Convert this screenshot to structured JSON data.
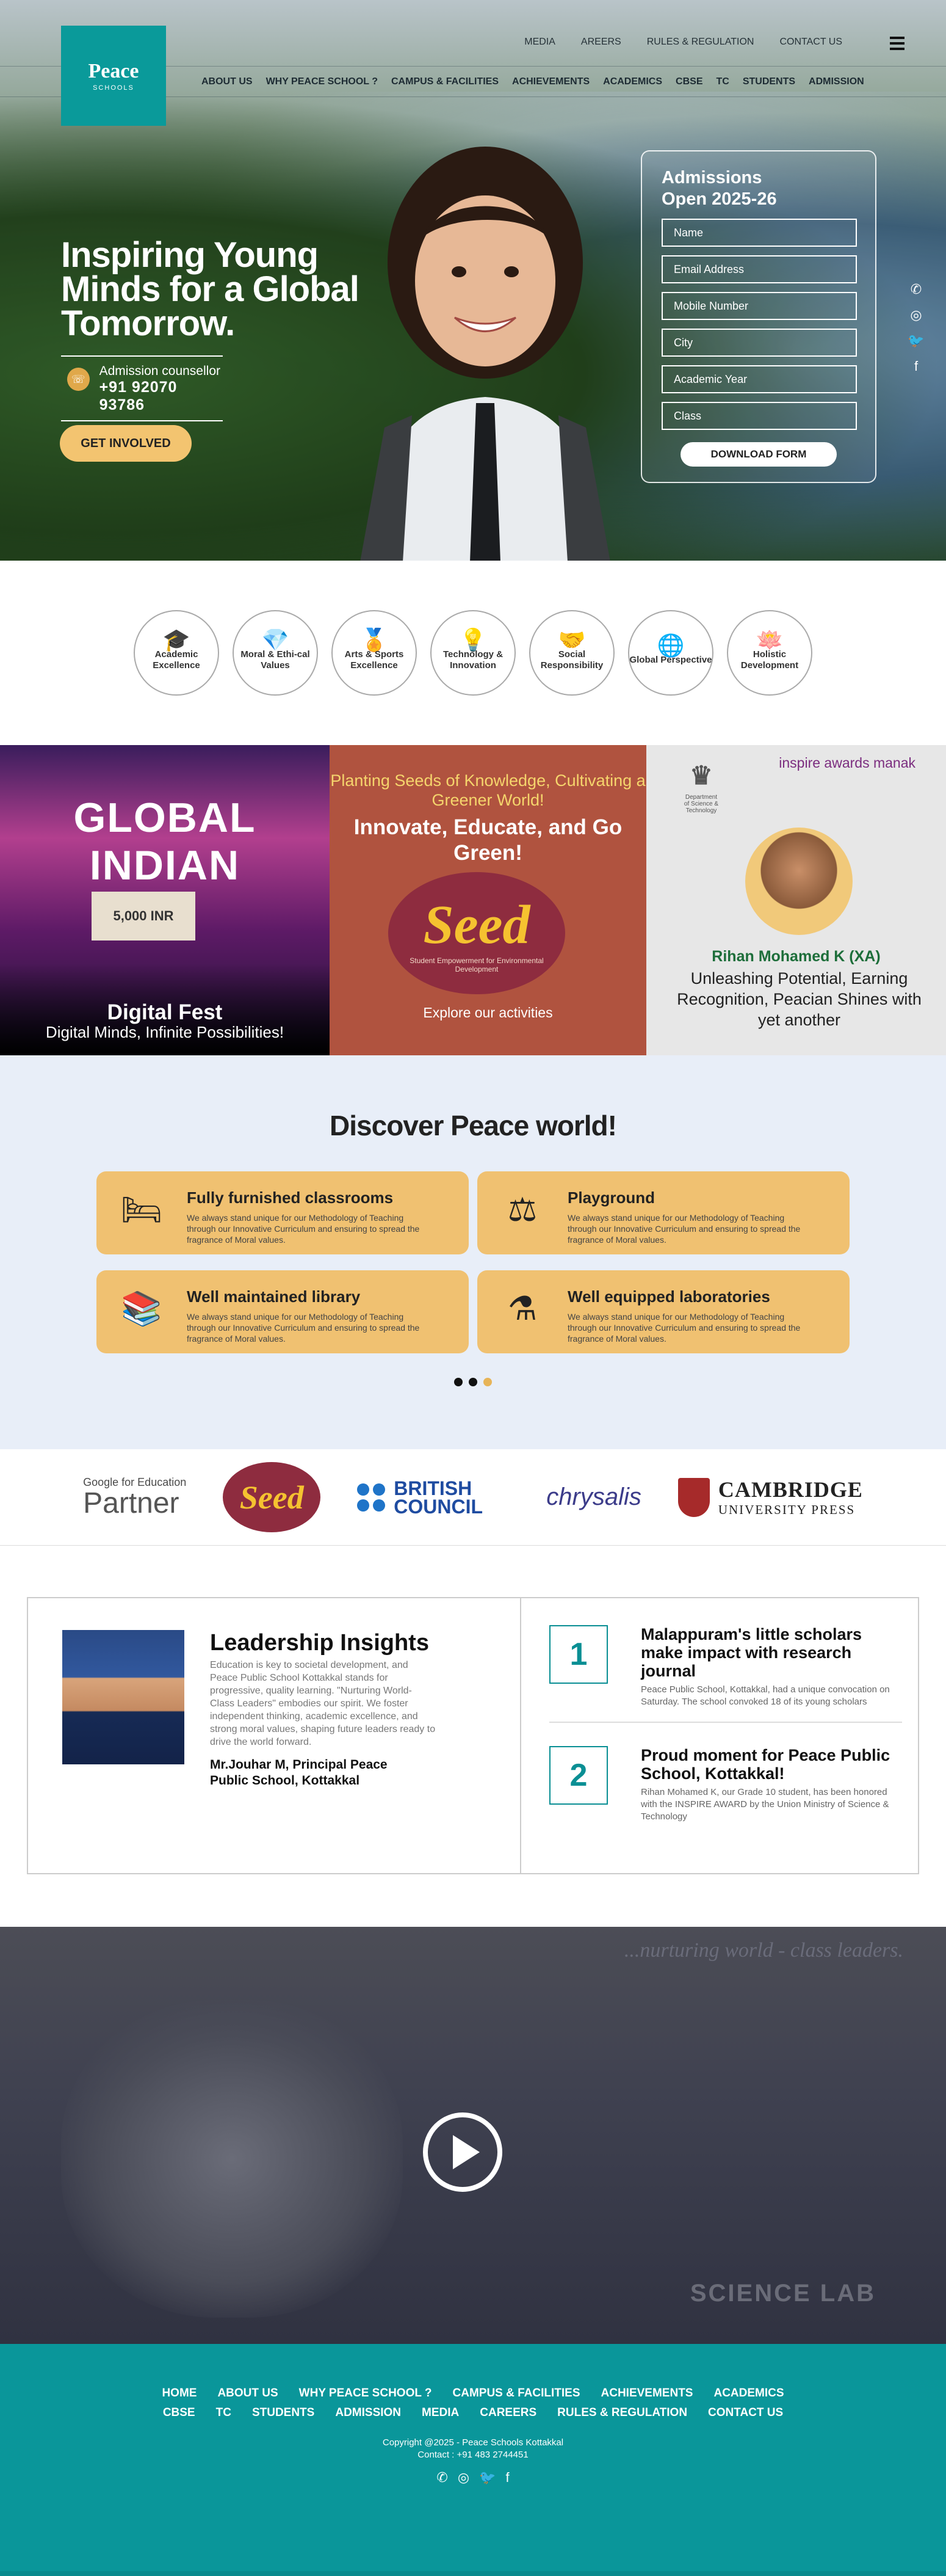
{
  "brand": {
    "name": "Peace",
    "sub": "SCHOOLS"
  },
  "topnav": {
    "row1": [
      "MEDIA",
      "AREERS",
      "RULES & REGULATION",
      "CONTACT US"
    ],
    "row2": [
      "ABOUT US",
      "WHY PEACE SCHOOL ?",
      "CAMPUS & FACILITIES",
      "ACHIEVEMENTS",
      "ACADEMICS",
      "CBSE",
      "TC",
      "STUDENTS",
      "ADMISSION"
    ]
  },
  "hero": {
    "headline": "Inspiring Young Minds for a Global Tomorrow.",
    "counsellor_label": "Admission counsellor",
    "counsellor_phone": "+91 92070 93786",
    "cta": "GET INVOLVED"
  },
  "form": {
    "title_line1": "Admissions",
    "title_line2": "Open 2025-26",
    "fields": [
      "Name",
      "Email Address",
      "Mobile Number",
      "City",
      "Academic Year",
      "Class"
    ],
    "button": "DOWNLOAD FORM"
  },
  "values": [
    {
      "icon": "🎓",
      "label": "Academic Excellence"
    },
    {
      "icon": "💎",
      "label": "Moral & Ethi-cal Values"
    },
    {
      "icon": "🏅",
      "label": "Arts & Sports Excellence"
    },
    {
      "icon": "💡",
      "label": "Technology & Innovation"
    },
    {
      "icon": "🤝",
      "label": "Social Responsibility"
    },
    {
      "icon": "🌐",
      "label": "Global Perspective"
    },
    {
      "icon": "🪷",
      "label": "Holistic Development"
    }
  ],
  "events": {
    "digital": {
      "banner": "GLOBAL INDIAN",
      "board": "5,000 INR",
      "title": "Digital Fest",
      "subtitle": "Digital Minds, Infinite Possibilities!"
    },
    "seed": {
      "tag": "Planting Seeds of Knowledge, Cultivating a Greener World!",
      "headline": "Innovate, Educate, and Go Green!",
      "logo": "Seed",
      "logo_sub": "Student Empowerment for Environmental Development",
      "link": "Explore our activities"
    },
    "inspire": {
      "ministry": "Department of Science & Technology",
      "award": "inspire awards manak",
      "name": "Rihan Mohamed K (XA)",
      "desc": "Unleashing Potential, Earning Recognition, Peacian Shines with yet another"
    }
  },
  "discover": {
    "title": "Discover Peace world!",
    "cards": [
      {
        "icon": "🛏",
        "title": "Fully furnished classrooms",
        "desc": "We always stand unique for our Methodology of Teaching through our Innovative Curriculum and ensuring to spread the fragrance of Moral values."
      },
      {
        "icon": "⚖",
        "title": "Playground",
        "desc": "We always stand unique for our Methodology of Teaching through our Innovative Curriculum and ensuring to spread the fragrance of Moral values."
      },
      {
        "icon": "📚",
        "title": "Well maintained library",
        "desc": "We always stand unique for our Methodology of Teaching through our Innovative Curriculum and ensuring to spread the fragrance of Moral values."
      },
      {
        "icon": "⚗",
        "title": "Well equipped laboratories",
        "desc": "We always stand unique for our Methodology of Teaching through our Innovative Curriculum and ensuring to spread the fragrance of Moral values."
      }
    ]
  },
  "partners": {
    "google_top": "Google for Education",
    "google_big": "Partner",
    "seed": "Seed",
    "british": "BRITISH COUNCIL",
    "chrysalis": "chrysalis",
    "cambridge_1": "CAMBRIDGE",
    "cambridge_2": "UNIVERSITY PRESS"
  },
  "leadership": {
    "title": "Leadership Insights",
    "text": "Education is key to societal development, and Peace Public School Kottakkal stands for progressive, quality learning. \"Nurturing World-Class Leaders\" embodies our spirit. We foster independent thinking, academic excellence, and strong moral values, shaping future leaders ready to drive the world forward.",
    "who": "Mr.Jouhar M, Principal Peace Public School, Kottakkal"
  },
  "news": [
    {
      "num": "1",
      "title": "Malappuram's little scholars make impact with research journal",
      "desc": "Peace Public School, Kottakkal, had a unique convocation on Saturday. The school convoked 18 of its young scholars"
    },
    {
      "num": "2",
      "title": "Proud moment for Peace Public School, Kottakkal!",
      "desc": "Rihan Mohamed K, our Grade 10 student, has been honored with the INSPIRE AWARD by the Union Ministry of Science & Technology"
    }
  ],
  "video": {
    "tagline": "...nurturing world - class leaders.",
    "lab": "SCIENCE LAB"
  },
  "footer": {
    "row1": [
      "HOME",
      "ABOUT US",
      "WHY PEACE SCHOOL ?",
      "CAMPUS & FACILITIES",
      "ACHIEVEMENTS",
      "ACADEMICS"
    ],
    "row2": [
      "CBSE",
      "TC",
      "STUDENTS",
      "ADMISSION",
      "MEDIA",
      "CAREERS",
      "RULES & REGULATION",
      "CONTACT US"
    ],
    "copyright": "Copyright @2025 - Peace Schools Kottakkal",
    "contact": "Contact : +91 483 2744451"
  },
  "colors": {
    "teal": "#0a969a",
    "gold": "#f0c171",
    "seed_bg": "#b0533f"
  }
}
